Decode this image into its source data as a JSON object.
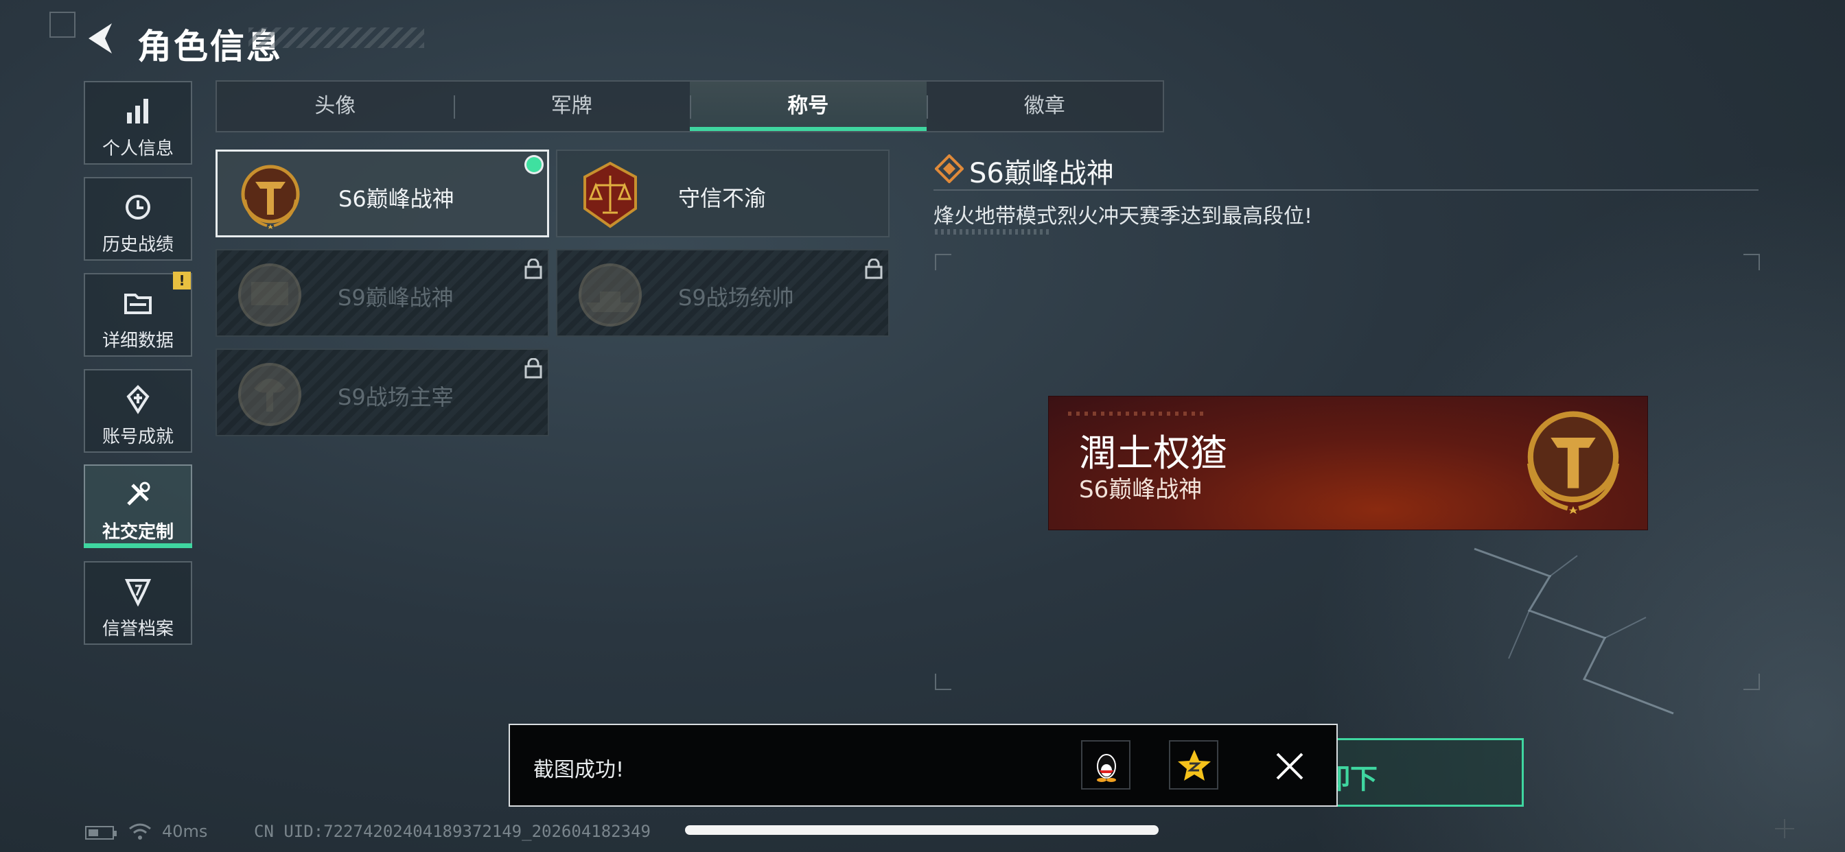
{
  "header": {
    "title": "角色信息"
  },
  "sidebar": {
    "items": [
      {
        "label": "个人信息",
        "icon": "bar-chart-icon"
      },
      {
        "label": "历史战绩",
        "icon": "history-icon"
      },
      {
        "label": "详细数据",
        "icon": "folder-icon",
        "badge": "!"
      },
      {
        "label": "账号成就",
        "icon": "achievement-icon"
      },
      {
        "label": "社交定制",
        "icon": "tools-icon",
        "active": true
      },
      {
        "label": "信誉档案",
        "icon": "shield-icon"
      }
    ]
  },
  "tabs": [
    {
      "label": "头像"
    },
    {
      "label": "军牌"
    },
    {
      "label": "称号",
      "active": true
    },
    {
      "label": "徽章"
    }
  ],
  "titles": [
    {
      "name": "S6巅峰战神",
      "state": "selected",
      "emblem": "s6-gold-emblem"
    },
    {
      "name": "守信不渝",
      "state": "unlocked",
      "emblem": "scales-emblem"
    },
    {
      "name": "S9巅峰战神",
      "state": "locked",
      "emblem": "fortress-emblem"
    },
    {
      "name": "S9战场统帅",
      "state": "locked",
      "emblem": "battleship-emblem"
    },
    {
      "name": "S9战场主宰",
      "state": "locked",
      "emblem": "mushroom-cloud-emblem"
    }
  ],
  "detail": {
    "title": "S6巅峰战神",
    "description": "烽火地带模式烈火冲天赛季达到最高段位!",
    "preview": {
      "player_name": "潤土权猹",
      "title": "S6巅峰战神"
    }
  },
  "bottom_button": {
    "label": "卸下"
  },
  "toast": {
    "message": "截图成功!",
    "share_targets": [
      "qq-icon",
      "qzone-icon"
    ]
  },
  "status": {
    "ping": "40ms",
    "uid": "CN UID:7227420240418937214​9_202604182349"
  },
  "colors": {
    "accent": "#3fd6a0",
    "plate": "#5e1a12",
    "gold": "#c8902e"
  }
}
